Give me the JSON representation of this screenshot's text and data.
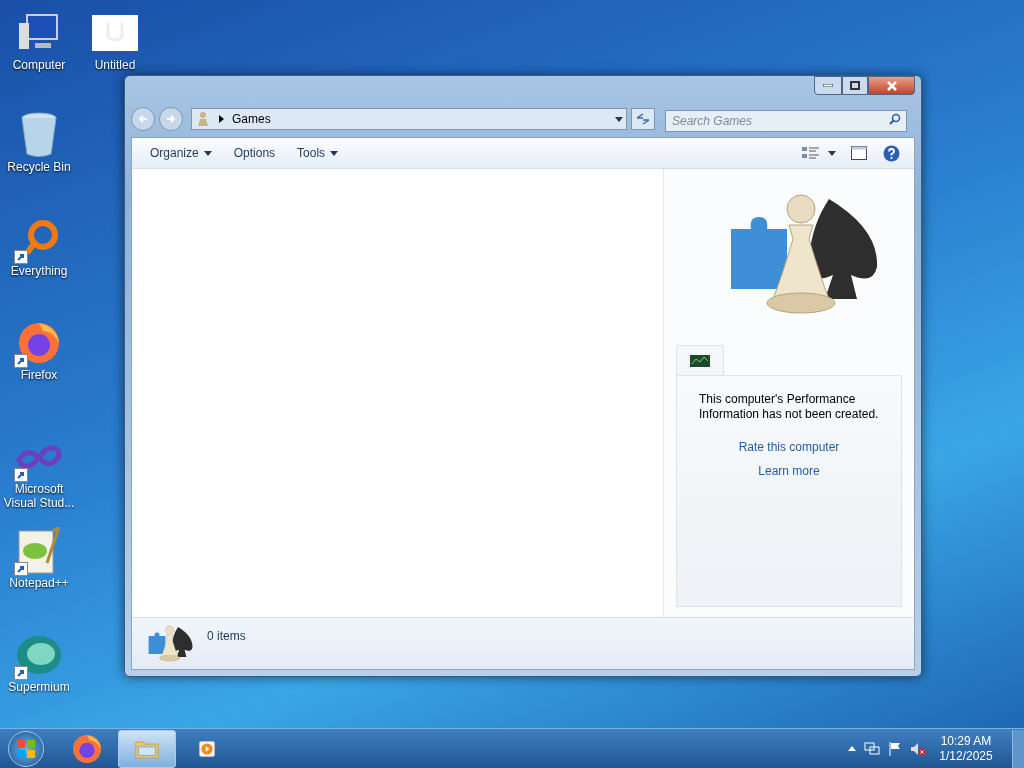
{
  "desktop_icons": [
    {
      "label": "Computer",
      "kind": "computer",
      "shortcut": false
    },
    {
      "label": "Untitled",
      "kind": "document",
      "shortcut": false
    },
    {
      "label": "Recycle Bin",
      "kind": "recycle",
      "shortcut": false
    },
    {
      "label": "Everything",
      "kind": "everything",
      "shortcut": true
    },
    {
      "label": "Firefox",
      "kind": "firefox",
      "shortcut": true
    },
    {
      "label": "Microsoft Visual Stud...",
      "kind": "vs",
      "shortcut": true
    },
    {
      "label": "Notepad++",
      "kind": "notepad",
      "shortcut": true
    },
    {
      "label": "Supermium",
      "kind": "supermium",
      "shortcut": true
    }
  ],
  "window": {
    "address": "Games",
    "search_placeholder": "Search Games",
    "toolbar": [
      {
        "label": "Organize",
        "dropdown": true
      },
      {
        "label": "Options",
        "dropdown": false
      },
      {
        "label": "Tools",
        "dropdown": true
      }
    ],
    "pane": {
      "message": "This computer's Performance Information has not been created.",
      "links": [
        "Rate this computer",
        "Learn more"
      ]
    },
    "status": "0 items"
  },
  "taskbar": {
    "items": [
      {
        "kind": "firefox",
        "selected": false
      },
      {
        "kind": "explorer",
        "selected": true
      },
      {
        "kind": "media",
        "selected": false
      }
    ],
    "time": "10:29 AM",
    "date": "1/12/2025"
  }
}
